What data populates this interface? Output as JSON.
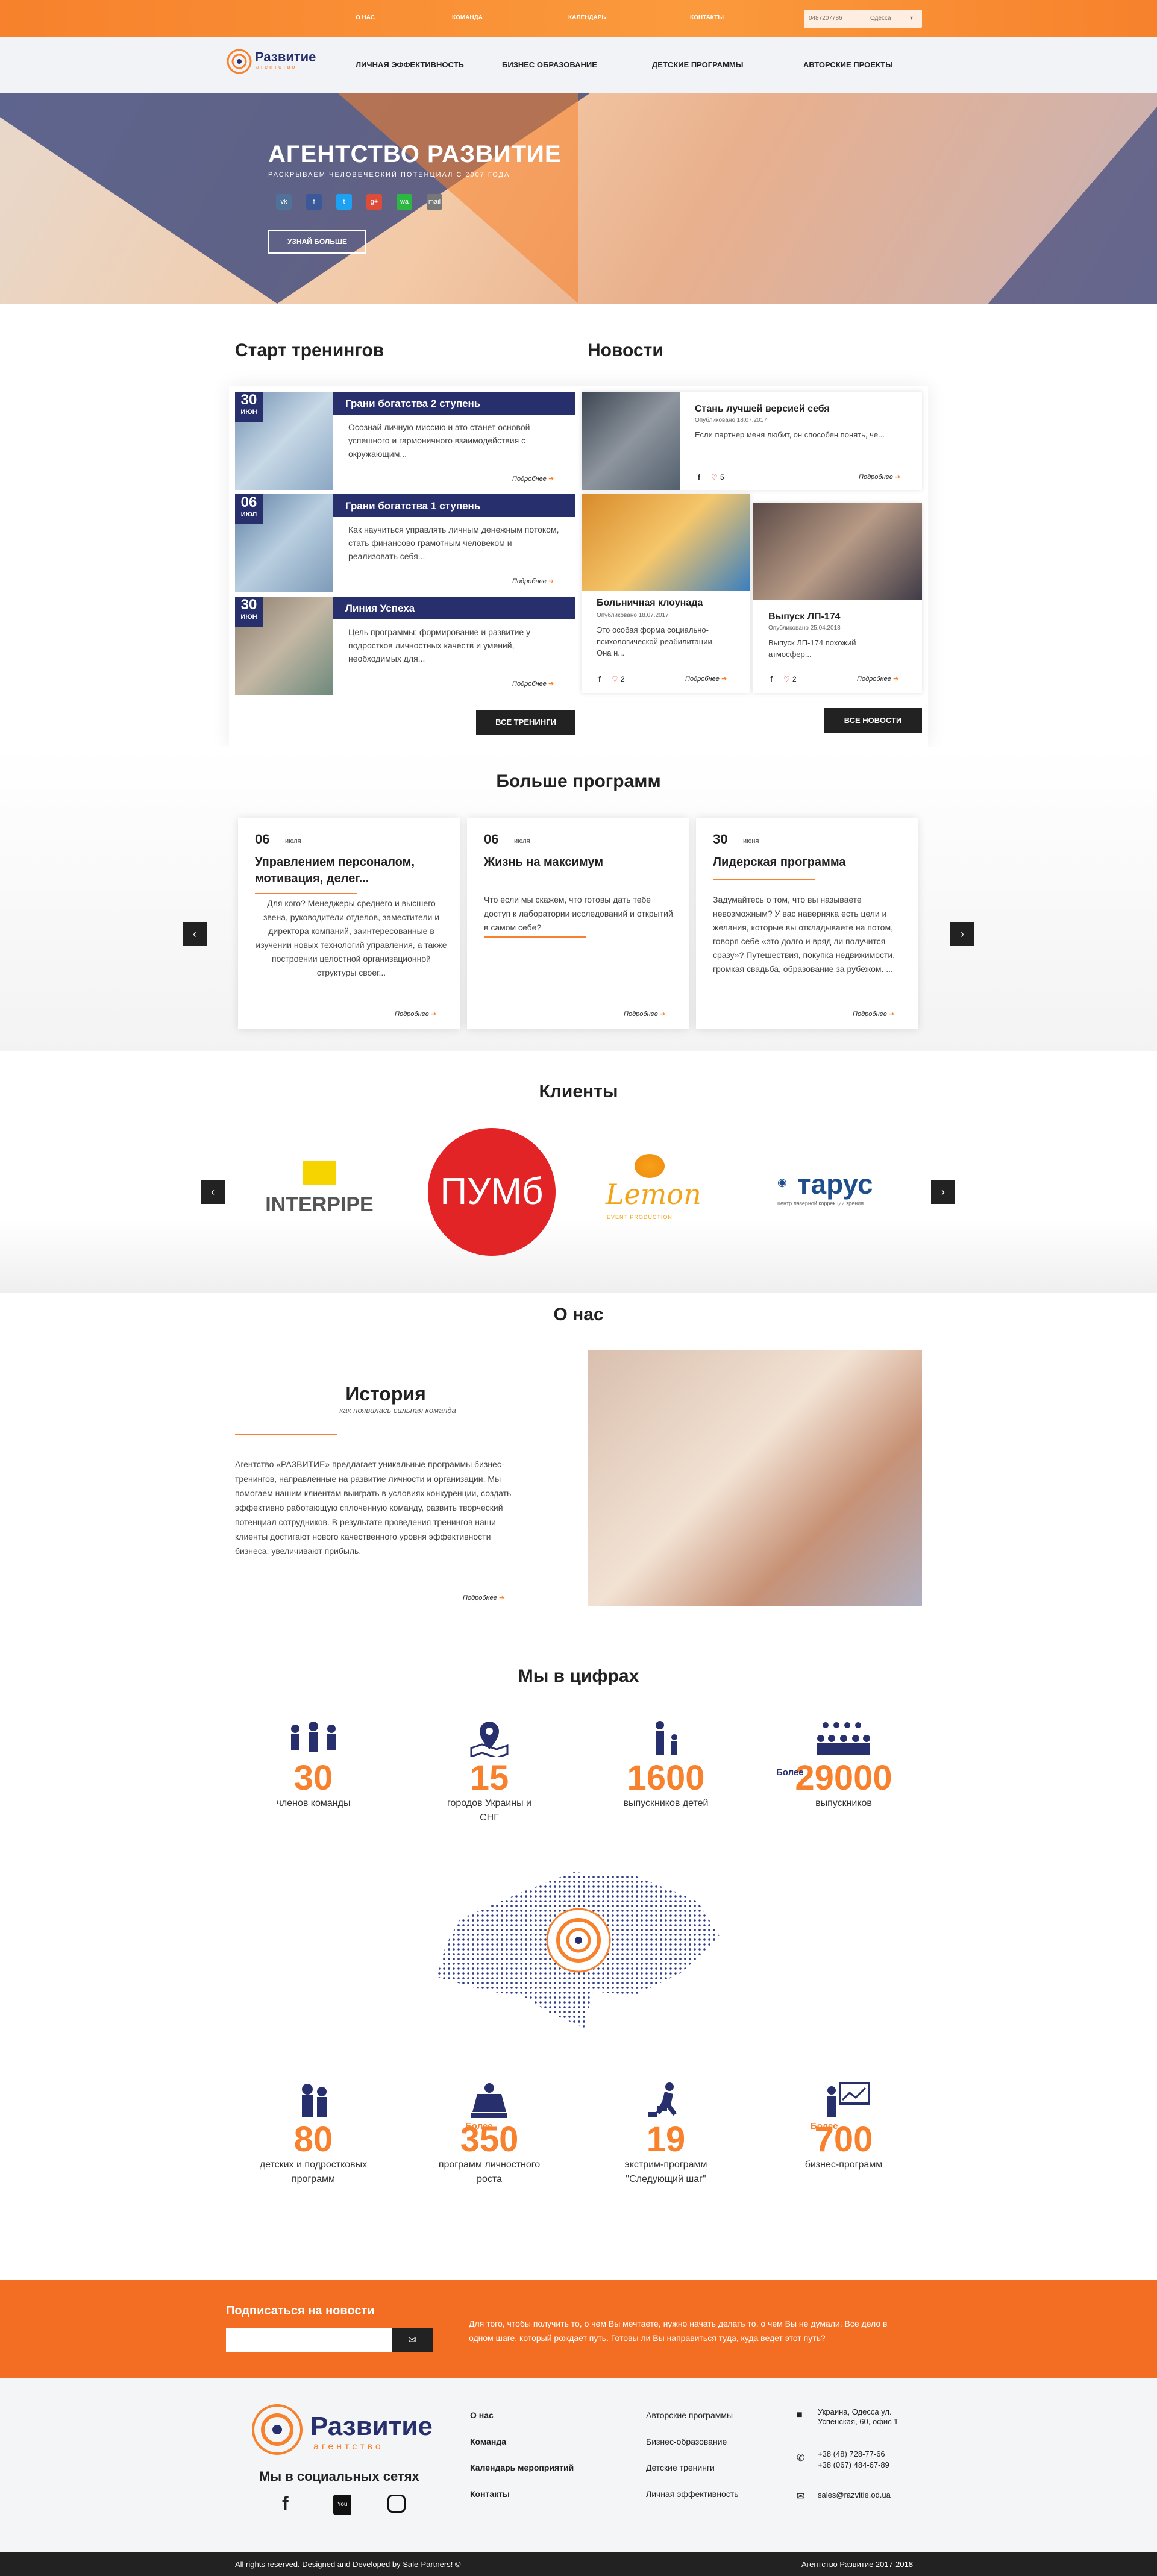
{
  "topbar": {
    "links": [
      "о нас",
      "команда",
      "календарь",
      "контакты"
    ],
    "phone": "0487207786",
    "city": "Одесса"
  },
  "nav": {
    "logo_text": "Развитие",
    "logo_sub": "агентство",
    "items": [
      "личная эффективность",
      "бизнес образование",
      "детские программы",
      "авторские проекты"
    ]
  },
  "hero": {
    "title": "Агентство Развитие",
    "subtitle": "Раскрываем человеческий потенциал с 2007 года",
    "social": [
      "vk",
      "f",
      "t",
      "g+",
      "wa",
      "mail"
    ],
    "button": "Узнай больше"
  },
  "trainings": {
    "title": "Старт тренингов",
    "items": [
      {
        "day": "30",
        "month": "июн",
        "title": "Грани богатства 2 ступень",
        "text": "Осознай личную миссию и это станет основой успешного и гармоничного взаимодействия с окружающим..."
      },
      {
        "day": "06",
        "month": "июл",
        "title": "Грани богатства 1 ступень",
        "text": "Как научиться управлять личным денежным потоком, стать финансово грамотным человеком и реализовать себя..."
      },
      {
        "day": "30",
        "month": "июн",
        "title": "Линия Успеха",
        "text": "Цель программы: формирование и развитие у подростков личностных качеств и умений, необходимых для..."
      }
    ],
    "more": "Подробнее",
    "button": "Все тренинги"
  },
  "news": {
    "title": "Новости",
    "items": [
      {
        "title": "Стань лучшей версией себя",
        "date": "Опубликовано 18.07.2017",
        "text": "Если партнер меня любит, он способен понять, че...",
        "likes": "5"
      },
      {
        "title": "Больничная клоунада",
        "date": "Опубликовано 18.07.2017",
        "text": "Это особая форма социально-психологической реабилитации. Она н...",
        "likes": "2"
      },
      {
        "title": "Выпуск ЛП-174",
        "date": "Опубликовано 25.04.2018",
        "text": "Выпуск ЛП-174 похожий атмосфер...",
        "likes": "2"
      }
    ],
    "more": "Подробнее",
    "button": "Все новости"
  },
  "programs": {
    "title": "Больше программ",
    "items": [
      {
        "day": "06",
        "month": "июля",
        "title": "Управлением персоналом, мотивация, делег...",
        "text": "Для кого? Менеджеры среднего и высшего звена, руководители отделов, заместители и директора компаний, заинтересованные в изучении новых технологий управления, а также построении целостной организационной структуры своег..."
      },
      {
        "day": "06",
        "month": "июля",
        "title": "Жизнь на максимум",
        "text": "Что если мы скажем, что готовы дать тебе доступ к лаборатории исследований и открытий в самом себе?"
      },
      {
        "day": "30",
        "month": "июня",
        "title": "Лидерская программа",
        "text": "Задумайтесь о том, что вы называете невозможным? У вас наверняка есть цели и желания, которые вы откладываете на потом, говоря себе «это долго и вряд ли получится сразу»? Путешествия, покупка недвижимости, громкая свадьба, образование за рубежом. ..."
      }
    ],
    "more": "Подробнее"
  },
  "clients": {
    "title": "Клиенты",
    "items": [
      "INTERPIPE",
      "ПУМб",
      "Lemon",
      "тарус"
    ],
    "lemon_sub": "EVENT PRODUCTION",
    "tarus_sub": "центр лазерной коррекции зрения"
  },
  "about": {
    "title": "О нас",
    "heading": "История",
    "subheading": "как появилась сильная команда",
    "text": "Агентство «РАЗВИТИЕ» предлагает уникальные программы бизнес-тренингов, направленные на развитие личности и организации. Мы помогаем нашим клиентам выиграть в условиях конкуренции, создать эффективно работающую сплоченную команду, развить творческий потенциал сотрудников. В результате проведения тренингов наши клиенты достигают нового качественного уровня эффективности бизнеса, увеличивают прибыль.",
    "more": "Подробнее"
  },
  "stats": {
    "title": "Мы в цифрах",
    "row1": [
      {
        "num": "30",
        "label": "членов команды",
        "prefix": ""
      },
      {
        "num": "15",
        "label": "городов Украины и СНГ",
        "prefix": ""
      },
      {
        "num": "1600",
        "label": "выпускников детей",
        "prefix": ""
      },
      {
        "num": "29000",
        "label": "выпускников",
        "prefix": "Более"
      }
    ],
    "row2": [
      {
        "num": "80",
        "label": "детских и подростковых программ",
        "prefix": ""
      },
      {
        "num": "350",
        "label": "программ личностного роста",
        "prefix": "Более"
      },
      {
        "num": "19",
        "label": "экстрим-программ \"Следующий шаг\"",
        "prefix": ""
      },
      {
        "num": "700",
        "label": "бизнес-программ",
        "prefix": "Более"
      }
    ]
  },
  "subscribe": {
    "title": "Подписаться на новости",
    "text": "Для того, чтобы получить то, о чем Вы мечтаете, нужно начать делать то, о чем Вы не думали. Все дело в одном шаге, который рождает путь. Готовы ли Вы направиться туда, куда ведет этот путь?"
  },
  "footer": {
    "social_title": "Мы в социальных сетях",
    "col1": [
      "О нас",
      "Команда",
      "Календарь мероприятий",
      "Контакты"
    ],
    "col2": [
      "Авторские программы",
      "Бизнес-образование",
      "Детские тренинги",
      "Личная эффективность"
    ],
    "address": "Украина, Одесса ул. Успенская, 60, офис 1",
    "phone1": "+38 (48) 728-77-66",
    "phone2": "+38 (067) 484-67-89",
    "email": "sales@razvitie.od.ua",
    "copyright": "All rights reserved. Designed and Developed by Sale-Partners! ©",
    "right": "Агентство Развитие 2017-2018"
  },
  "colors": {
    "accent": "#f7812c",
    "brand": "#27306c"
  }
}
